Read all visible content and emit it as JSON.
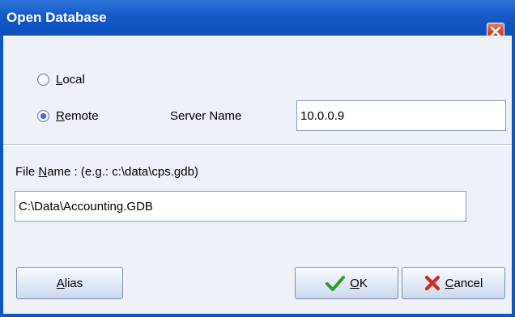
{
  "window": {
    "title": "Open Database"
  },
  "radio_local": {
    "label_first": "L",
    "label_rest": "ocal",
    "checked": false
  },
  "radio_remote": {
    "label_first": "R",
    "label_rest": "emote",
    "checked": true
  },
  "server": {
    "label": "Server Name",
    "value": "10.0.0.9"
  },
  "file": {
    "label_pre": "File ",
    "label_u": "N",
    "label_post": "ame :  (e.g.: c:\\data\\cps.gdb)",
    "value": "C:\\Data\\Accounting.GDB"
  },
  "buttons": {
    "alias_first": "A",
    "alias_rest": "lias",
    "ok_first": "O",
    "ok_rest": "K",
    "cancel_first": "C",
    "cancel_rest": "ancel"
  },
  "icons": {
    "ok": "checkmark-icon",
    "cancel": "x-icon",
    "close": "close-icon"
  },
  "colors": {
    "title_bar": "#1559c7",
    "ok_check": "#2f9a2f",
    "cancel_x": "#d12a1a"
  }
}
